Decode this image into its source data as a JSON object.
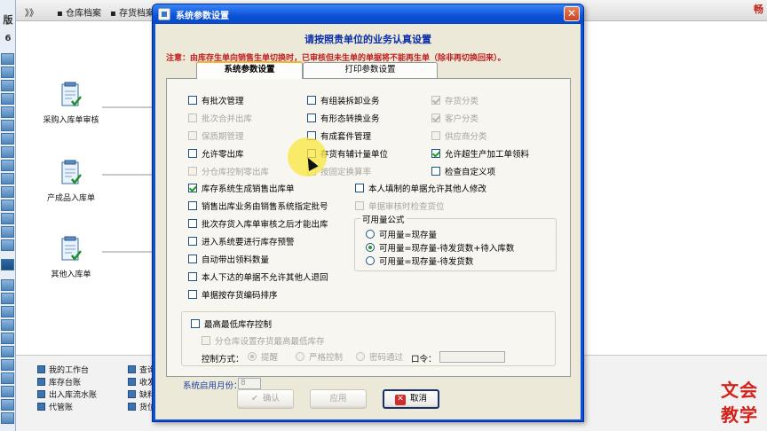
{
  "background": {
    "top_menu": [
      "》》",
      "仓库档案",
      "存货档案"
    ],
    "brand": "畅",
    "left_bar": {
      "title": "版",
      "number": "6"
    },
    "flow_nodes": [
      {
        "label": "采购入库单审核",
        "icon": "document-check-icon"
      },
      {
        "label": "产成品入库单",
        "icon": "document-check-icon"
      },
      {
        "label": "其他入库单",
        "icon": "document-check-icon"
      }
    ],
    "bottom_links_col1": [
      "我的工作台",
      "库存台账",
      "出入库流水账",
      "代管账"
    ],
    "bottom_links_col2": [
      "查询",
      "收发",
      "缺料",
      "货位"
    ],
    "watermark": [
      "文会",
      "教学"
    ]
  },
  "dialog": {
    "title": "系统参数设置",
    "close_glyph": "✕",
    "heading": "请按照贵单位的业务认真设置",
    "notice": "注意：由库存生单向销售生单切换时，已审核但未生单的单据将不能再生单（除非再切换回来）。",
    "tabs": [
      {
        "label": "系统参数设置",
        "active": true
      },
      {
        "label": "打印参数设置",
        "active": false
      }
    ],
    "col1": [
      {
        "label": "有批次管理",
        "checked": false,
        "disabled": false
      },
      {
        "label": "批次合并出库",
        "checked": false,
        "disabled": true
      },
      {
        "label": "保质期管理",
        "checked": false,
        "disabled": true
      },
      {
        "label": "允许零出库",
        "checked": false,
        "disabled": false
      },
      {
        "label": "分仓库控制零出库",
        "checked": false,
        "disabled": true
      },
      {
        "label": "库存系统生成销售出库单",
        "checked": true,
        "disabled": false
      },
      {
        "label": "销售出库业务由销售系统指定批号",
        "checked": false,
        "disabled": false
      },
      {
        "label": "批次存货入库单审核之后才能出库",
        "checked": false,
        "disabled": false
      },
      {
        "label": "进入系统要进行库存预警",
        "checked": false,
        "disabled": false
      },
      {
        "label": "自动带出领料数量",
        "checked": false,
        "disabled": false
      },
      {
        "label": "本人下达的单据不允许其他人退回",
        "checked": false,
        "disabled": false
      },
      {
        "label": "单据按存货编码排序",
        "checked": false,
        "disabled": false
      }
    ],
    "col2": [
      {
        "label": "有组装拆卸业务",
        "checked": false,
        "disabled": false
      },
      {
        "label": "有形态转换业务",
        "checked": false,
        "disabled": false
      },
      {
        "label": "有成套件管理",
        "checked": false,
        "disabled": false
      },
      {
        "label": "存货有辅计量单位",
        "checked": false,
        "disabled": false
      },
      {
        "label": "按固定换算率",
        "checked": false,
        "disabled": true
      }
    ],
    "col3": [
      {
        "label": "存货分类",
        "checked": true,
        "disabled": true
      },
      {
        "label": "客户分类",
        "checked": true,
        "disabled": true
      },
      {
        "label": "供应商分类",
        "checked": false,
        "disabled": true
      },
      {
        "label": "允许超生产加工单领料",
        "checked": true,
        "disabled": false
      },
      {
        "label": "检查自定义项",
        "checked": false,
        "disabled": false
      }
    ],
    "mid": [
      {
        "label": "本人填制的单据允许其他人修改",
        "checked": false,
        "disabled": false
      },
      {
        "label": "单据审核时检查货位",
        "checked": false,
        "disabled": true
      }
    ],
    "available_group": {
      "legend": "可用量公式",
      "options": [
        {
          "label": "可用量=现存量",
          "selected": false
        },
        {
          "label": "可用量=现存量-待发货数+待入库数",
          "selected": true
        },
        {
          "label": "可用量=现存量-待发货数",
          "selected": false
        }
      ]
    },
    "stock_group": {
      "legend": "最高最低库存控制",
      "checked": false,
      "sub": "分仓库设置存货最高最低库存",
      "mode_label": "控制方式：",
      "modes": [
        {
          "label": "提醒",
          "selected": true
        },
        {
          "label": "严格控制",
          "selected": false
        },
        {
          "label": "密码通过",
          "selected": false
        }
      ],
      "password_label": "口令："
    },
    "month_label": "系统启用月份：",
    "month_value": "8",
    "buttons": {
      "ok": {
        "label": "确认",
        "glyph": "✔"
      },
      "apply": {
        "label": "应用",
        "glyph": ""
      },
      "cancel": {
        "label": "取消",
        "glyph": "✕"
      }
    }
  }
}
